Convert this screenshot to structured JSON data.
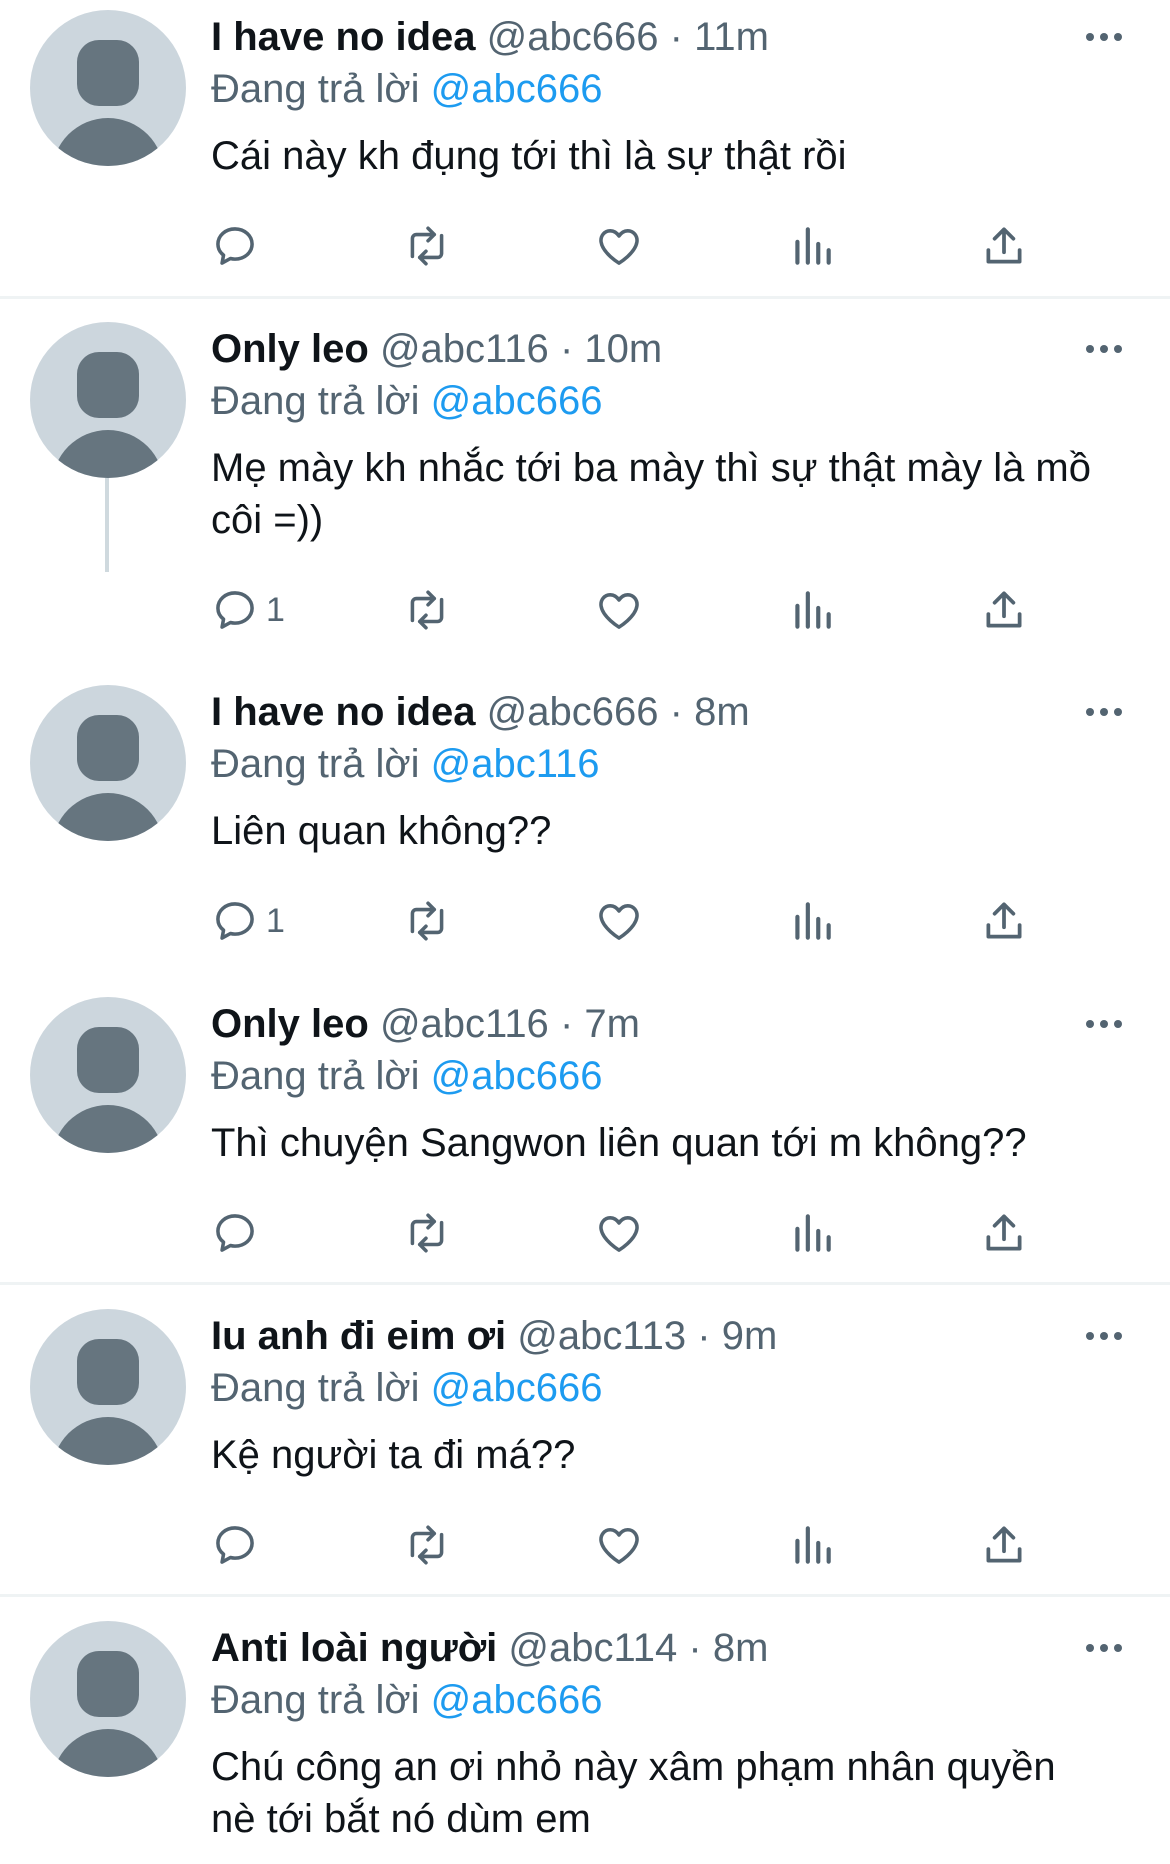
{
  "replying_label": "Đang trả lời",
  "colors": {
    "accent": "#1d9bf0",
    "secondary_text": "#536471",
    "avatar_bg": "#ccd6dd",
    "avatar_fg": "#66757f",
    "divider": "#eff3f4"
  },
  "tweets": [
    {
      "name": "I have no idea",
      "handle": "@abc666",
      "time": "11m",
      "reply_to": "@abc666",
      "text": "Cái này kh đụng tới thì là sự thật rồi",
      "reply_count": ""
    },
    {
      "name": "Only leo",
      "handle": "@abc116",
      "time": "10m",
      "reply_to": "@abc666",
      "text": "Mẹ mày kh nhắc tới ba mày thì sự thật mày là mồ côi =))",
      "reply_count": "1"
    },
    {
      "name": "I have no idea",
      "handle": "@abc666",
      "time": "8m",
      "reply_to": "@abc116",
      "text": "Liên quan không??",
      "reply_count": "1"
    },
    {
      "name": "Only leo",
      "handle": "@abc116",
      "time": "7m",
      "reply_to": "@abc666",
      "text": "Thì chuyện Sangwon liên quan tới m không??",
      "reply_count": ""
    },
    {
      "name": "Iu anh đi eim ơi",
      "handle": "@abc113",
      "time": "9m",
      "reply_to": "@abc666",
      "text": "Kệ người ta đi má??",
      "reply_count": ""
    },
    {
      "name": "Anti loài người",
      "handle": "@abc114",
      "time": "8m",
      "reply_to": "@abc666",
      "text": "Chú công an ơi nhỏ này xâm phạm nhân quyền nè tới bắt nó dùm em",
      "reply_count": ""
    }
  ],
  "icons": {
    "reply": "reply-bubble-icon",
    "retweet": "retweet-icon",
    "like": "heart-icon",
    "views": "bar-chart-icon",
    "share": "share-upload-icon",
    "more": "more-dots-icon"
  }
}
